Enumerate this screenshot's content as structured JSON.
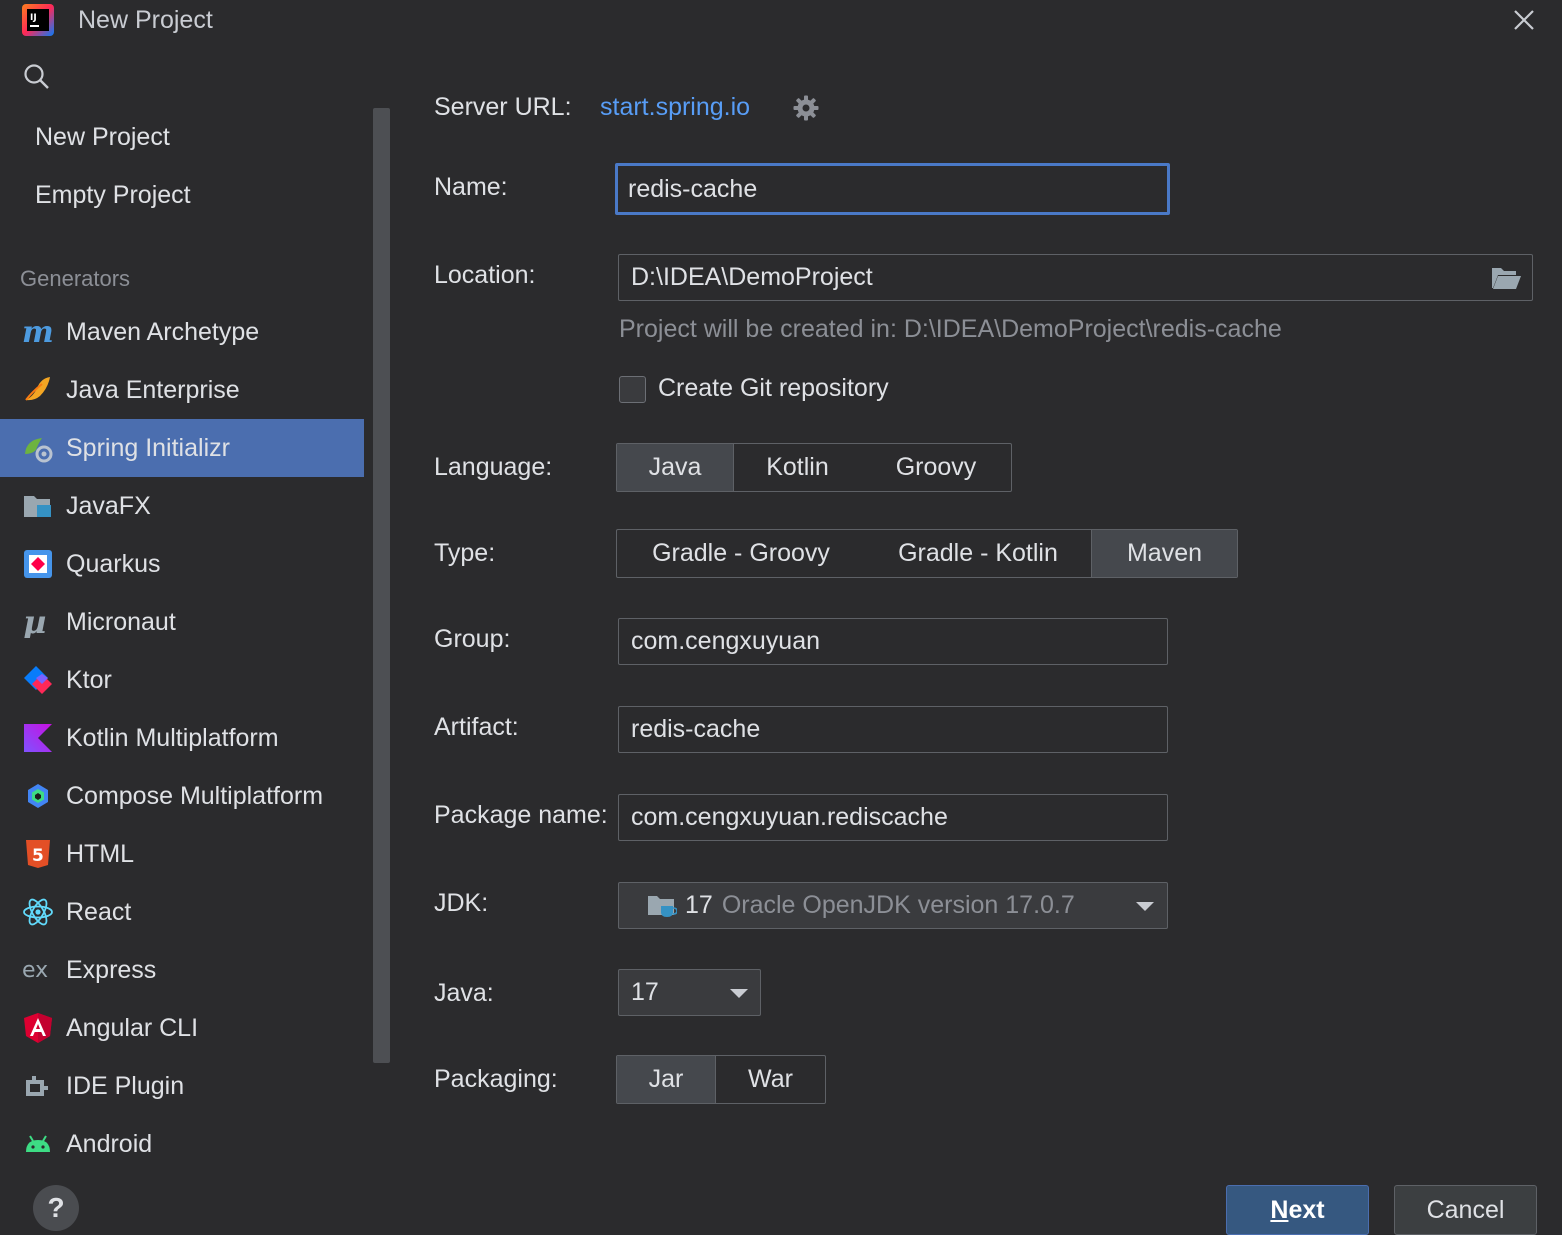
{
  "window": {
    "title": "New Project"
  },
  "sidebar": {
    "top_items": [
      {
        "label": "New Project"
      },
      {
        "label": "Empty Project"
      }
    ],
    "generators_header": "Generators",
    "generators": [
      {
        "label": "Maven Archetype",
        "icon": "maven-icon"
      },
      {
        "label": "Java Enterprise",
        "icon": "java-enterprise-icon"
      },
      {
        "label": "Spring Initializr",
        "icon": "spring-icon",
        "selected": true
      },
      {
        "label": "JavaFX",
        "icon": "javafx-icon"
      },
      {
        "label": "Quarkus",
        "icon": "quarkus-icon"
      },
      {
        "label": "Micronaut",
        "icon": "micronaut-icon"
      },
      {
        "label": "Ktor",
        "icon": "ktor-icon"
      },
      {
        "label": "Kotlin Multiplatform",
        "icon": "kotlin-icon"
      },
      {
        "label": "Compose Multiplatform",
        "icon": "compose-icon"
      },
      {
        "label": "HTML",
        "icon": "html5-icon"
      },
      {
        "label": "React",
        "icon": "react-icon"
      },
      {
        "label": "Express",
        "icon": "express-icon"
      },
      {
        "label": "Angular CLI",
        "icon": "angular-icon"
      },
      {
        "label": "IDE Plugin",
        "icon": "plugin-icon"
      },
      {
        "label": "Android",
        "icon": "android-icon"
      }
    ]
  },
  "form": {
    "server_url_label": "Server URL:",
    "server_url": "start.spring.io",
    "name_label": "Name:",
    "name": "redis-cache",
    "location_label": "Location:",
    "location": "D:\\IDEA\\DemoProject",
    "location_hint": "Project will be created in: D:\\IDEA\\DemoProject\\redis-cache",
    "git_label": "Create Git repository",
    "git_checked": false,
    "language_label": "Language:",
    "languages": [
      "Java",
      "Kotlin",
      "Groovy"
    ],
    "language_selected": "Java",
    "type_label": "Type:",
    "types": [
      "Gradle - Groovy",
      "Gradle - Kotlin",
      "Maven"
    ],
    "type_selected": "Maven",
    "group_label": "Group:",
    "group": "com.cengxuyuan",
    "artifact_label": "Artifact:",
    "artifact": "redis-cache",
    "package_label": "Package name:",
    "package": "com.cengxuyuan.rediscache",
    "jdk_label": "JDK:",
    "jdk_version": "17",
    "jdk_desc": "Oracle OpenJDK version 17.0.7",
    "java_label": "Java:",
    "java_version": "17",
    "packaging_label": "Packaging:",
    "packagings": [
      "Jar",
      "War"
    ],
    "packaging_selected": "Jar"
  },
  "footer": {
    "help": "?",
    "next_mnemonic": "N",
    "next_rest": "ext",
    "cancel": "Cancel"
  },
  "colors": {
    "background": "#2b2b2d",
    "selection": "#4b6eaf",
    "link": "#589df6",
    "primary_button": "#365880"
  }
}
